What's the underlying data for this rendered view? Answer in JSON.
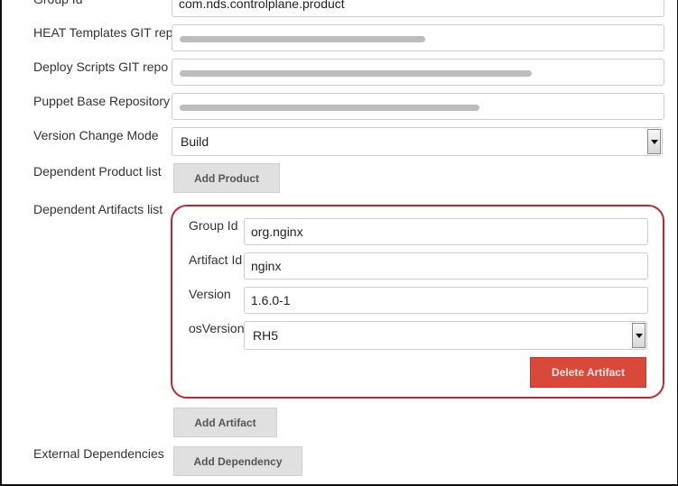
{
  "form": {
    "group_id": {
      "label": "Group Id",
      "value": "com.nds.controlplane.product"
    },
    "heat_repo": {
      "label": "HEAT Templates GIT repo",
      "value": "[redacted]"
    },
    "deploy_repo": {
      "label": "Deploy Scripts GIT repo",
      "value": "[redacted]"
    },
    "puppet_repo": {
      "label": "Puppet Base Repository",
      "value": "[redacted]"
    },
    "version_change_mode": {
      "label": "Version Change Mode",
      "value": "Build"
    },
    "dependent_products": {
      "label": "Dependent Product list",
      "add_button": "Add Product"
    },
    "dependent_artifacts": {
      "label": "Dependent Artifacts list",
      "artifact": {
        "group_id": {
          "label": "Group Id",
          "value": "org.nginx"
        },
        "artifact_id": {
          "label": "Artifact Id",
          "value": "nginx"
        },
        "version": {
          "label": "Version",
          "value": "1.6.0-1"
        },
        "os_version": {
          "label": "osVersion",
          "value": "RH5"
        },
        "delete_button": "Delete Artifact"
      },
      "add_button": "Add Artifact"
    },
    "external_dependencies": {
      "label": "External Dependencies",
      "add_button": "Add Dependency"
    }
  },
  "colors": {
    "highlight_border": "#c4242f",
    "danger_button": "#d9493a",
    "default_button": "#e0e0e0"
  }
}
